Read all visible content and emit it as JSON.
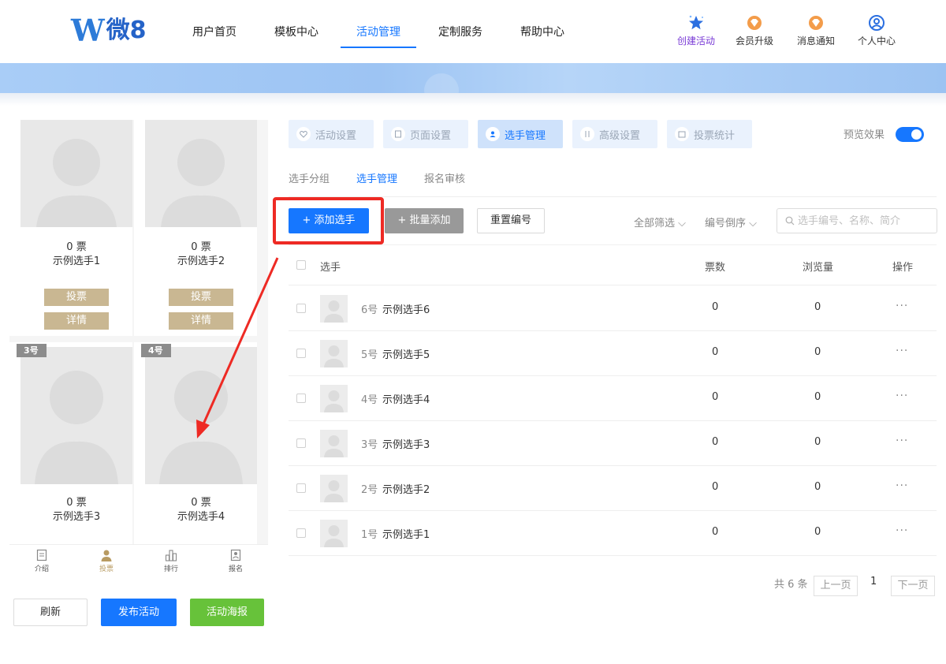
{
  "brand": {
    "logo_mark": "W",
    "logo_text": "微8"
  },
  "nav": {
    "items": [
      {
        "label": "用户首页"
      },
      {
        "label": "模板中心"
      },
      {
        "label": "活动管理"
      },
      {
        "label": "定制服务"
      },
      {
        "label": "帮助中心"
      }
    ],
    "active_index": 2
  },
  "quick_links": {
    "create": "创建活动",
    "upgrade": "会员升级",
    "notify": "消息通知",
    "profile": "个人中心"
  },
  "preview": {
    "cards": [
      {
        "votes": "0 票",
        "name": "示例选手1",
        "vote_btn": "投票",
        "detail_btn": "详情"
      },
      {
        "votes": "0 票",
        "name": "示例选手2",
        "vote_btn": "投票",
        "detail_btn": "详情"
      },
      {
        "tag": "3号",
        "votes": "0 票",
        "name": "示例选手3"
      },
      {
        "tag": "4号",
        "votes": "0 票",
        "name": "示例选手4"
      }
    ],
    "tabs": [
      {
        "label": "介绍"
      },
      {
        "label": "投票"
      },
      {
        "label": "排行"
      },
      {
        "label": "报名"
      }
    ],
    "active_tab": 1
  },
  "left_buttons": {
    "refresh": "刷新",
    "publish": "发布活动",
    "poster": "活动海报"
  },
  "steps": [
    {
      "label": "活动设置"
    },
    {
      "label": "页面设置"
    },
    {
      "label": "选手管理"
    },
    {
      "label": "高级设置"
    },
    {
      "label": "投票统计"
    }
  ],
  "active_step": 2,
  "preview_toggle": {
    "label": "预览效果",
    "on": true
  },
  "subtabs": [
    {
      "label": "选手分组"
    },
    {
      "label": "选手管理"
    },
    {
      "label": "报名审核"
    }
  ],
  "active_subtab": 1,
  "toolbar": {
    "add": "+ 添加选手",
    "batch": "+ 批量添加",
    "renumber": "重置编号",
    "filter": "全部筛选 ⌵",
    "sort": "编号倒序 ⌵",
    "search_placeholder": "选手编号、名称、简介"
  },
  "table": {
    "headers": {
      "player": "选手",
      "votes": "票数",
      "views": "浏览量",
      "actions": "操作"
    },
    "rows": [
      {
        "num": "6号",
        "name": "示例选手6",
        "votes": "0",
        "views": "0",
        "ops": "···"
      },
      {
        "num": "5号",
        "name": "示例选手5",
        "votes": "0",
        "views": "0",
        "ops": "···"
      },
      {
        "num": "4号",
        "name": "示例选手4",
        "votes": "0",
        "views": "0",
        "ops": "···"
      },
      {
        "num": "3号",
        "name": "示例选手3",
        "votes": "0",
        "views": "0",
        "ops": "···"
      },
      {
        "num": "2号",
        "name": "示例选手2",
        "votes": "0",
        "views": "0",
        "ops": "···"
      },
      {
        "num": "1号",
        "name": "示例选手1",
        "votes": "0",
        "views": "0",
        "ops": "···"
      }
    ]
  },
  "pagination": {
    "total": "共 6 条",
    "prev": "上一页",
    "current": "1",
    "next": "下一页"
  },
  "colors": {
    "primary": "#1677ff",
    "highlight": "#ee2a24",
    "gold": "#c9b792",
    "green": "#67c23a"
  }
}
